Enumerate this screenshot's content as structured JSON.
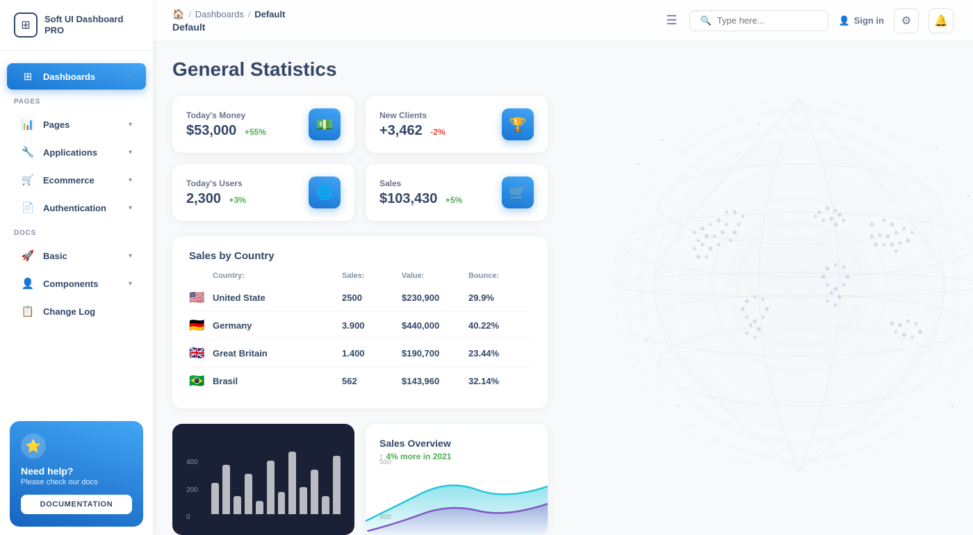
{
  "app": {
    "name": "Soft UI Dashboard PRO",
    "logo_symbol": "⊞"
  },
  "breadcrumb": {
    "home_icon": "🏠",
    "separator": "/",
    "parent": "Dashboards",
    "current": "Default"
  },
  "header": {
    "page_title": "Default",
    "search_placeholder": "Type here...",
    "signin_label": "Sign in",
    "hamburger_icon": "☰"
  },
  "sidebar": {
    "pages_label": "PAGES",
    "docs_label": "DOCS",
    "items_pages": [
      {
        "id": "dashboards",
        "label": "Dashboards",
        "icon": "⊞",
        "active": true,
        "has_arrow": true
      },
      {
        "id": "pages",
        "label": "Pages",
        "icon": "📊",
        "active": false,
        "has_arrow": true
      },
      {
        "id": "applications",
        "label": "Applications",
        "icon": "🔧",
        "active": false,
        "has_arrow": true
      },
      {
        "id": "ecommerce",
        "label": "Ecommerce",
        "icon": "🛒",
        "active": false,
        "has_arrow": true
      },
      {
        "id": "authentication",
        "label": "Authentication",
        "icon": "📄",
        "active": false,
        "has_arrow": true
      }
    ],
    "items_docs": [
      {
        "id": "basic",
        "label": "Basic",
        "icon": "🚀",
        "has_arrow": true
      },
      {
        "id": "components",
        "label": "Components",
        "icon": "👤",
        "has_arrow": true
      },
      {
        "id": "changelog",
        "label": "Change Log",
        "icon": "📋",
        "has_arrow": false
      }
    ],
    "help": {
      "star": "⭐",
      "title": "Need help?",
      "subtitle": "Please check our docs",
      "button_label": "DOCUMENTATION"
    }
  },
  "main": {
    "heading": "General Statistics",
    "stats": [
      {
        "label": "Today's Money",
        "value": "$53,000",
        "badge": "+55%",
        "badge_type": "green",
        "icon": "💵"
      },
      {
        "label": "New Clients",
        "value": "+3,462",
        "badge": "-2%",
        "badge_type": "red",
        "icon": "🏆"
      },
      {
        "label": "Today's Users",
        "value": "2,300",
        "badge": "+3%",
        "badge_type": "green",
        "icon": "🌐"
      },
      {
        "label": "Sales",
        "value": "$103,430",
        "badge": "+5%",
        "badge_type": "green",
        "icon": "🛒"
      }
    ],
    "sales_by_country": {
      "title": "Sales by Country",
      "columns": [
        "Country:",
        "Sales:",
        "Value:",
        "Bounce:"
      ],
      "rows": [
        {
          "flag": "🇺🇸",
          "country": "United State",
          "sales": "2500",
          "value": "$230,900",
          "bounce": "29.9%"
        },
        {
          "flag": "🇩🇪",
          "country": "Germany",
          "sales": "3.900",
          "value": "$440,000",
          "bounce": "40.22%"
        },
        {
          "flag": "🇬🇧",
          "country": "Great Britain",
          "sales": "1.400",
          "value": "$190,700",
          "bounce": "23.44%"
        },
        {
          "flag": "🇧🇷",
          "country": "Brasil",
          "sales": "562",
          "value": "$143,960",
          "bounce": "32.14%"
        }
      ]
    },
    "sales_overview": {
      "title": "Sales Overview",
      "subtitle": "4% more in 2021",
      "y_labels": [
        "500",
        "400"
      ],
      "bars": [
        35,
        55,
        20,
        45,
        15,
        60,
        25,
        70,
        30,
        50,
        20,
        65
      ]
    }
  }
}
